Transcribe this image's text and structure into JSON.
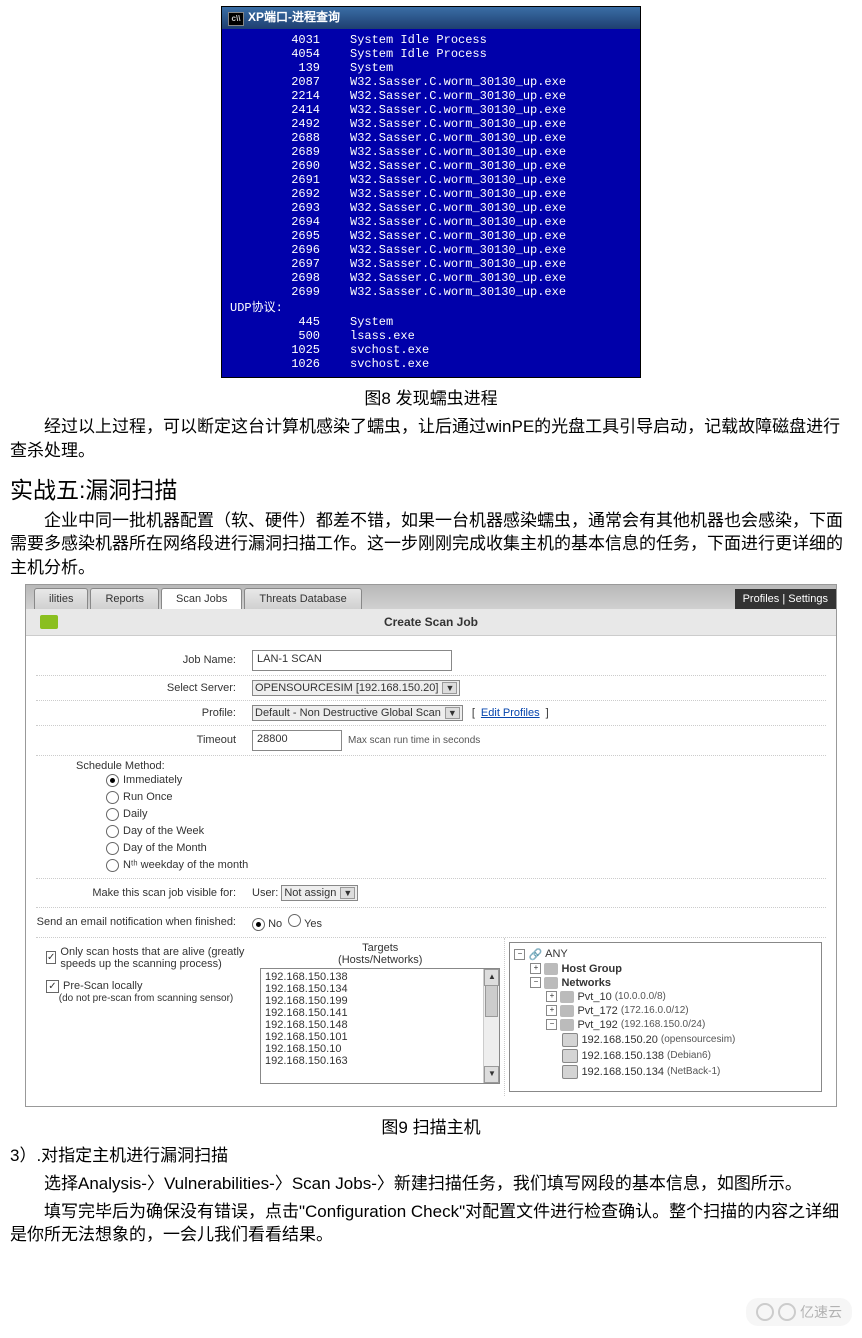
{
  "fig8": {
    "title": "XP端口-进程查询",
    "rows": [
      {
        "pid": "4031",
        "proc": "System Idle Process"
      },
      {
        "pid": "4054",
        "proc": "System Idle Process"
      },
      {
        "pid": "139",
        "proc": "System"
      },
      {
        "pid": "2087",
        "proc": "W32.Sasser.C.worm_30130_up.exe"
      },
      {
        "pid": "2214",
        "proc": "W32.Sasser.C.worm_30130_up.exe"
      },
      {
        "pid": "2414",
        "proc": "W32.Sasser.C.worm_30130_up.exe"
      },
      {
        "pid": "2492",
        "proc": "W32.Sasser.C.worm_30130_up.exe"
      },
      {
        "pid": "2688",
        "proc": "W32.Sasser.C.worm_30130_up.exe"
      },
      {
        "pid": "2689",
        "proc": "W32.Sasser.C.worm_30130_up.exe"
      },
      {
        "pid": "2690",
        "proc": "W32.Sasser.C.worm_30130_up.exe"
      },
      {
        "pid": "2691",
        "proc": "W32.Sasser.C.worm_30130_up.exe"
      },
      {
        "pid": "2692",
        "proc": "W32.Sasser.C.worm_30130_up.exe"
      },
      {
        "pid": "2693",
        "proc": "W32.Sasser.C.worm_30130_up.exe"
      },
      {
        "pid": "2694",
        "proc": "W32.Sasser.C.worm_30130_up.exe"
      },
      {
        "pid": "2695",
        "proc": "W32.Sasser.C.worm_30130_up.exe"
      },
      {
        "pid": "2696",
        "proc": "W32.Sasser.C.worm_30130_up.exe"
      },
      {
        "pid": "2697",
        "proc": "W32.Sasser.C.worm_30130_up.exe"
      },
      {
        "pid": "2698",
        "proc": "W32.Sasser.C.worm_30130_up.exe"
      },
      {
        "pid": "2699",
        "proc": "W32.Sasser.C.worm_30130_up.exe"
      }
    ],
    "udp_label": "UDP协议:",
    "udp_rows": [
      {
        "pid": "445",
        "proc": "System"
      },
      {
        "pid": "500",
        "proc": "lsass.exe"
      },
      {
        "pid": "1025",
        "proc": "svchost.exe"
      },
      {
        "pid": "1026",
        "proc": "svchost.exe"
      }
    ]
  },
  "captions": {
    "fig8": "图8 发现蠕虫进程",
    "fig9": "图9 扫描主机"
  },
  "text": {
    "p1": "经过以上过程，可以断定这台计算机感染了蠕虫，让后通过winPE的光盘工具引导启动，记载故障磁盘进行查杀处理。",
    "h2": "实战五:漏洞扫描",
    "p2": "企业中同一批机器配置（软、硬件）都差不错，如果一台机器感染蠕虫，通常会有其他机器也会感染，下面需要多感染机器所在网络段进行漏洞扫描工作。这一步刚刚完成收集主机的基本信息的任务，下面进行更详细的主机分析。",
    "p3_title": "3）.对指定主机进行漏洞扫描",
    "p3": "选择Analysis-〉Vulnerabilities-〉Scan Jobs-〉新建扫描任务，我们填写网段的基本信息，如图所示。",
    "p4": "填写完毕后为确保没有错误，点击\"Configuration Check\"对配置文件进行检查确认。整个扫描的内容之详细是你所无法想象的，一会儿我们看看结果。"
  },
  "scan": {
    "tabs": {
      "t1": "ilities",
      "t2": "Reports",
      "t3": "Scan Jobs",
      "t4": "Threats Database",
      "right": "Profiles | Settings"
    },
    "header": "Create Scan Job",
    "labels": {
      "jobname": "Job Name:",
      "server": "Select Server:",
      "profile": "Profile:",
      "timeout": "Timeout",
      "timeout_hint": "Max scan run time in seconds",
      "schedule": "Schedule Method:",
      "visible": "Make this scan job visible for:",
      "user": "User:",
      "email": "Send an email notification when finished:",
      "onlyalive": "Only scan hosts that are alive (greatly speeds up the scanning process)",
      "prescan": "Pre-Scan locally",
      "noprescan": "(do not pre-scan from scanning sensor)",
      "targets": "Targets",
      "targets_sub": "(Hosts/Networks)",
      "editprofiles": "Edit Profiles"
    },
    "values": {
      "jobname": "LAN-1 SCAN",
      "server": "OPENSOURCESIM [192.168.150.20]",
      "profile": "Default - Non Destructive Global Scan",
      "timeout": "28800",
      "user_select": "Not assign"
    },
    "sched_opts": [
      "Immediately",
      "Run Once",
      "Daily",
      "Day of the Week",
      "Day of the Month",
      "Nᵗʰ weekday of the month"
    ],
    "radio": {
      "no": "No",
      "yes": "Yes"
    },
    "target_list": [
      "192.168.150.138",
      "192.168.150.134",
      "192.168.150.199",
      "192.168.150.141",
      "192.168.150.148",
      "192.168.150.101",
      "192.168.150.10",
      "192.168.150.163"
    ],
    "tree": {
      "any": "ANY",
      "hostgroup": "Host Group",
      "networks": "Networks",
      "pvt10": "Pvt_10",
      "pvt10r": "(10.0.0.0/8)",
      "pvt172": "Pvt_172",
      "pvt172r": "(172.16.0.0/12)",
      "pvt192": "Pvt_192",
      "pvt192r": "(192.168.150.0/24)",
      "h1": "192.168.150.20",
      "h1s": "(opensourcesim)",
      "h2": "192.168.150.138",
      "h2s": "(Debian6)",
      "h3": "192.168.150.134",
      "h3s": "(NetBack-1)"
    }
  },
  "watermark": "亿速云"
}
